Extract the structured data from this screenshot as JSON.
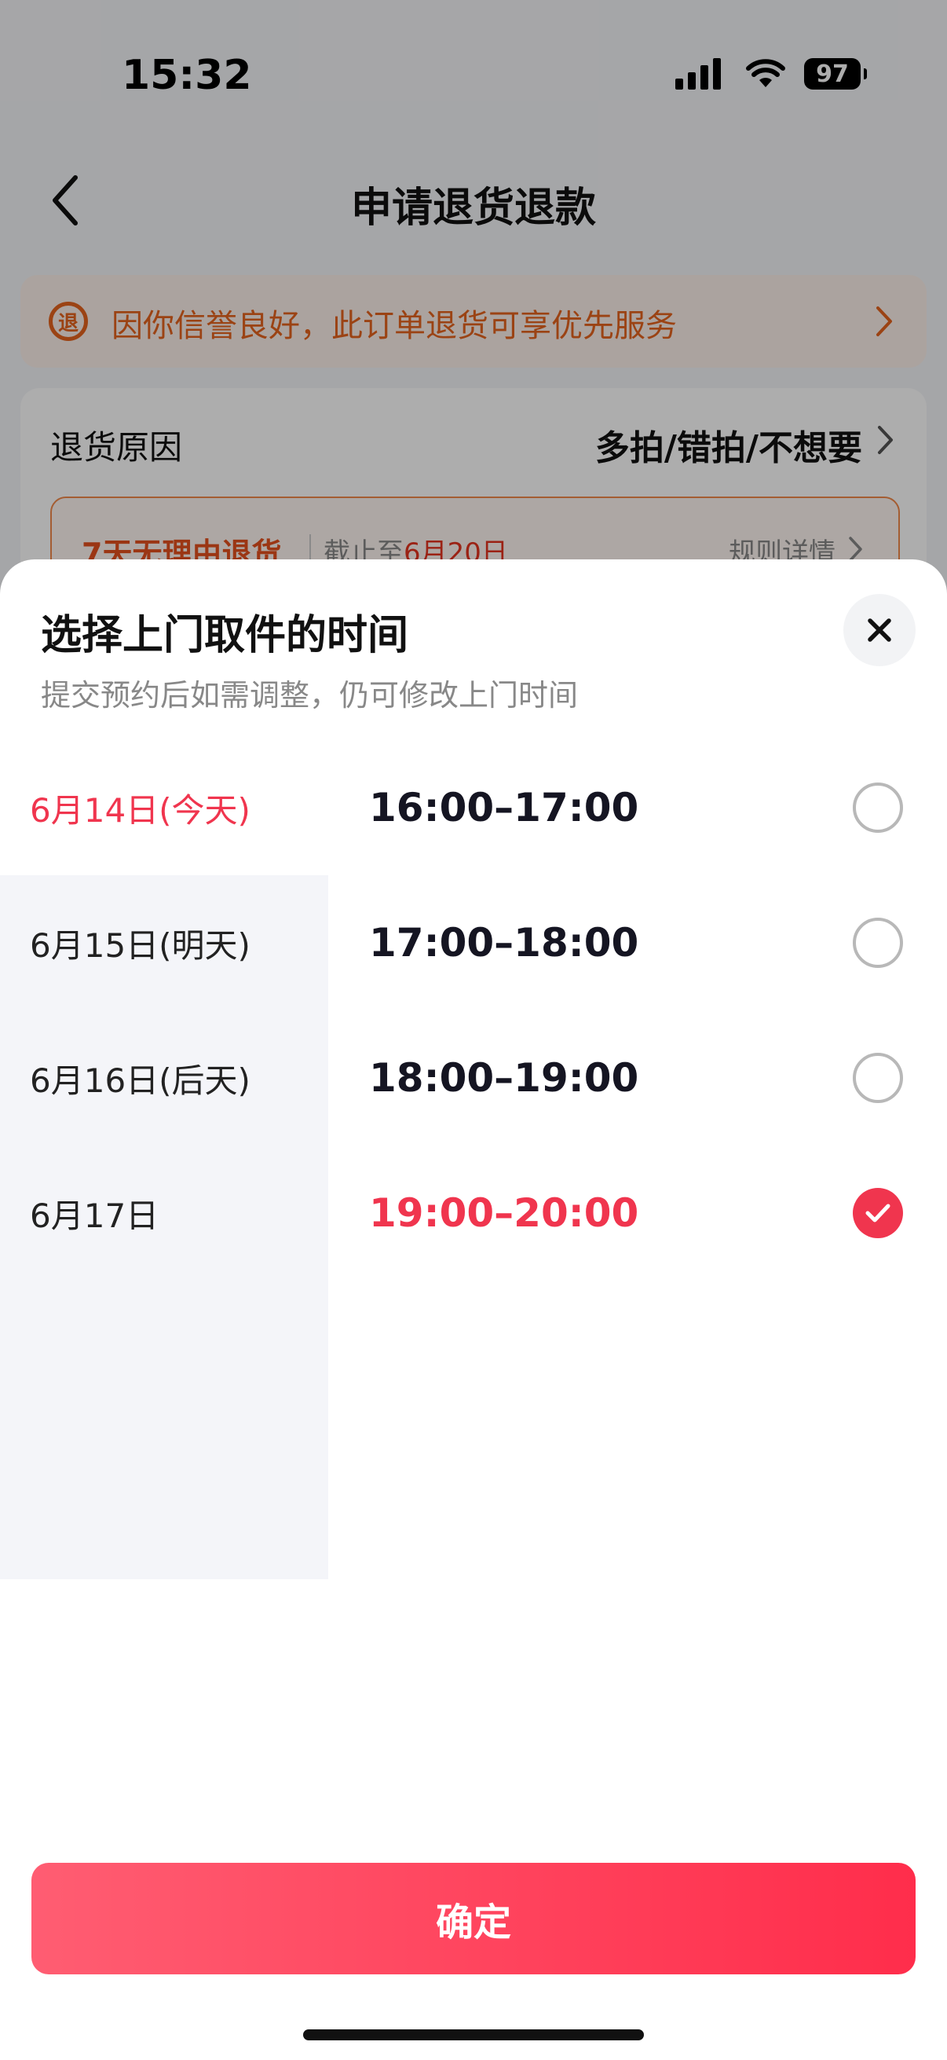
{
  "status_bar": {
    "time": "15:32",
    "battery": "97"
  },
  "nav": {
    "title": "申请退货退款"
  },
  "notice": {
    "icon_text": "退",
    "text": "因你信誉良好，此订单退货可享优先服务",
    "color": "#e5631e"
  },
  "reason": {
    "label": "退货原因",
    "value": "多拍/错拍/不想要"
  },
  "policy": {
    "title": "7天无理由退货",
    "deadline_prefix": "截止至",
    "deadline_date": "6月20日",
    "link": "规则详情"
  },
  "sheet": {
    "title": "选择上门取件的时间",
    "subtitle": "提交预约后如需调整，仍可修改上门时间",
    "accent_color": "#f0354e",
    "dates": [
      {
        "label": "6月14日(今天)",
        "active": true
      },
      {
        "label": "6月15日(明天)",
        "active": false
      },
      {
        "label": "6月16日(后天)",
        "active": false
      },
      {
        "label": "6月17日",
        "active": false
      }
    ],
    "time_slots": [
      {
        "label": "16:00–17:00",
        "selected": false
      },
      {
        "label": "17:00–18:00",
        "selected": false
      },
      {
        "label": "18:00–19:00",
        "selected": false
      },
      {
        "label": "19:00–20:00",
        "selected": true
      }
    ],
    "confirm_label": "确定"
  },
  "icons": [
    "back-icon",
    "refund-icon",
    "chevron-right-icon",
    "close-icon",
    "check-icon",
    "signal-icon",
    "wifi-icon",
    "battery-icon"
  ]
}
